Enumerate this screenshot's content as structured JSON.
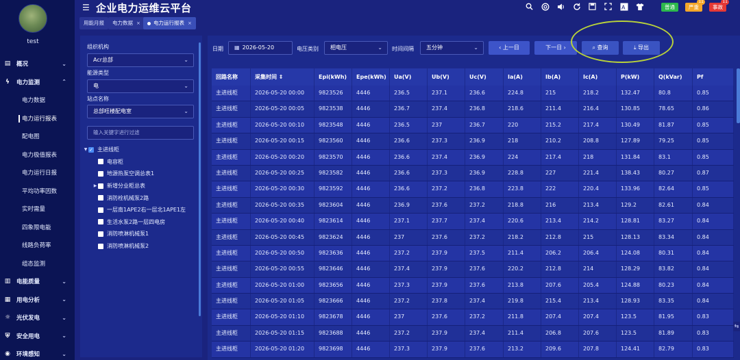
{
  "user": {
    "name": "test"
  },
  "app_title": "企业电力运维云平台",
  "header": {
    "badges": [
      {
        "label": "普通",
        "color": "#2db84d",
        "count": ""
      },
      {
        "label": "严重",
        "color": "#f4a62a",
        "count": "11"
      },
      {
        "label": "事故",
        "color": "#e53935",
        "count": "11"
      }
    ]
  },
  "nav": {
    "groups_before": [
      {
        "label": "概况",
        "icon": "chart-icon"
      }
    ],
    "active_group": {
      "label": "电力监测",
      "icon": "lightning-icon"
    },
    "sub_items": [
      "电力数据",
      "电力运行报表",
      "配电图",
      "电力极值报表",
      "电力运行日报",
      "平均功率因数",
      "实时需量",
      "四象限电能",
      "线路负荷率",
      "组态监测"
    ],
    "active_sub": "电力运行报表",
    "groups_after": [
      {
        "label": "电能质量",
        "icon": "wave-icon"
      },
      {
        "label": "用电分析",
        "icon": "analysis-icon"
      },
      {
        "label": "光伏发电",
        "icon": "solar-icon"
      },
      {
        "label": "安全用电",
        "icon": "shield-icon"
      },
      {
        "label": "环境感知",
        "icon": "env-icon"
      }
    ]
  },
  "tabs": [
    {
      "label": "用能月报",
      "closable": false
    },
    {
      "label": "电力数据",
      "closable": true
    },
    {
      "label": "电力运行报表",
      "closable": true,
      "active": true
    }
  ],
  "filter": {
    "org_label": "组织机构",
    "org_value": "Acr总部",
    "energy_label": "能源类型",
    "energy_value": "电",
    "station_label": "站点名称",
    "station_value": "总部旺楼配电室",
    "search_placeholder": "输入关键字进行过滤",
    "tree": [
      {
        "label": "主进线柜",
        "level": 0,
        "checked": true,
        "expand": "open"
      },
      {
        "label": "电容柜",
        "level": 1,
        "checked": false,
        "expand": ""
      },
      {
        "label": "地源热泵空调总表1",
        "level": 1,
        "checked": false,
        "expand": ""
      },
      {
        "label": "新增分业柜总表",
        "level": 1,
        "checked": false,
        "expand": "closed"
      },
      {
        "label": "消防栓机械泵2路",
        "level": 1,
        "checked": false,
        "expand": ""
      },
      {
        "label": "一层南1APE2右一层北1APE1左",
        "level": 1,
        "checked": false,
        "expand": ""
      },
      {
        "label": "生活水泵2路一层四电房",
        "level": 1,
        "checked": false,
        "expand": ""
      },
      {
        "label": "消防喷淋机械泵1",
        "level": 1,
        "checked": false,
        "expand": ""
      },
      {
        "label": "消防喷淋机械泵2",
        "level": 1,
        "checked": false,
        "expand": ""
      }
    ]
  },
  "toolbar": {
    "date_label": "日期",
    "date_value": "2026-05-20",
    "voltage_label": "电压类别",
    "voltage_value": "相电压",
    "interval_label": "时间间隔",
    "interval_value": "五分钟",
    "prev_label": "上一日",
    "next_label": "下一日",
    "query_label": "查询",
    "export_label": "导出"
  },
  "table": {
    "headers": [
      "回路名称",
      "采集时间",
      "Epi(kWh)",
      "Epe(kWh)",
      "Ua(V)",
      "Ub(V)",
      "Uc(V)",
      "Ia(A)",
      "Ib(A)",
      "Ic(A)",
      "P(kW)",
      "Q(kVar)",
      "Pf"
    ],
    "rows": [
      [
        "主进线柜",
        "2026-05-20 00:00",
        "9823526",
        "4446",
        "236.5",
        "237.1",
        "236.6",
        "224.8",
        "215",
        "218.2",
        "132.47",
        "80.8",
        "0.85"
      ],
      [
        "主进线柜",
        "2026-05-20 00:05",
        "9823538",
        "4446",
        "236.7",
        "237.4",
        "236.8",
        "218.6",
        "211.4",
        "216.4",
        "130.85",
        "78.65",
        "0.86"
      ],
      [
        "主进线柜",
        "2026-05-20 00:10",
        "9823548",
        "4446",
        "236.5",
        "237",
        "236.7",
        "220",
        "215.2",
        "217.4",
        "130.49",
        "81.87",
        "0.85"
      ],
      [
        "主进线柜",
        "2026-05-20 00:15",
        "9823560",
        "4446",
        "236.6",
        "237.3",
        "236.9",
        "218",
        "210.2",
        "208.8",
        "127.89",
        "79.25",
        "0.85"
      ],
      [
        "主进线柜",
        "2026-05-20 00:20",
        "9823570",
        "4446",
        "236.6",
        "237.4",
        "236.9",
        "224",
        "217.4",
        "218",
        "131.84",
        "83.1",
        "0.85"
      ],
      [
        "主进线柜",
        "2026-05-20 00:25",
        "9823582",
        "4446",
        "236.6",
        "237.3",
        "236.9",
        "228.8",
        "227",
        "221.4",
        "138.43",
        "80.27",
        "0.87"
      ],
      [
        "主进线柜",
        "2026-05-20 00:30",
        "9823592",
        "4446",
        "236.6",
        "237.2",
        "236.8",
        "223.8",
        "222",
        "220.4",
        "133.96",
        "82.64",
        "0.85"
      ],
      [
        "主进线柜",
        "2026-05-20 00:35",
        "9823604",
        "4446",
        "236.9",
        "237.6",
        "237.2",
        "218.8",
        "216",
        "213.4",
        "129.2",
        "82.61",
        "0.84"
      ],
      [
        "主进线柜",
        "2026-05-20 00:40",
        "9823614",
        "4446",
        "237.1",
        "237.7",
        "237.4",
        "220.6",
        "213.4",
        "214.2",
        "128.81",
        "83.27",
        "0.84"
      ],
      [
        "主进线柜",
        "2026-05-20 00:45",
        "9823624",
        "4446",
        "237",
        "237.6",
        "237.2",
        "218.2",
        "212.8",
        "215",
        "128.13",
        "83.34",
        "0.84"
      ],
      [
        "主进线柜",
        "2026-05-20 00:50",
        "9823636",
        "4446",
        "237.2",
        "237.9",
        "237.5",
        "211.4",
        "206.2",
        "206.4",
        "124.08",
        "80.31",
        "0.84"
      ],
      [
        "主进线柜",
        "2026-05-20 00:55",
        "9823646",
        "4446",
        "237.4",
        "237.9",
        "237.6",
        "220.2",
        "212.8",
        "214",
        "128.29",
        "83.82",
        "0.84"
      ],
      [
        "主进线柜",
        "2026-05-20 01:00",
        "9823656",
        "4446",
        "237.3",
        "237.9",
        "237.6",
        "213.8",
        "207.6",
        "205.4",
        "124.88",
        "80.23",
        "0.84"
      ],
      [
        "主进线柜",
        "2026-05-20 01:05",
        "9823666",
        "4446",
        "237.2",
        "237.8",
        "237.4",
        "219.8",
        "215.4",
        "213.4",
        "128.93",
        "83.35",
        "0.84"
      ],
      [
        "主进线柜",
        "2026-05-20 01:10",
        "9823678",
        "4446",
        "237",
        "237.6",
        "237.2",
        "211.8",
        "207.4",
        "207.4",
        "123.5",
        "81.95",
        "0.83"
      ],
      [
        "主进线柜",
        "2026-05-20 01:15",
        "9823688",
        "4446",
        "237.2",
        "237.9",
        "237.4",
        "211.4",
        "206.8",
        "207.6",
        "123.5",
        "81.89",
        "0.83"
      ],
      [
        "主进线柜",
        "2026-05-20 01:20",
        "9823698",
        "4446",
        "237.3",
        "237.9",
        "237.6",
        "213.2",
        "209.6",
        "207.8",
        "124.41",
        "82.79",
        "0.83"
      ]
    ]
  }
}
